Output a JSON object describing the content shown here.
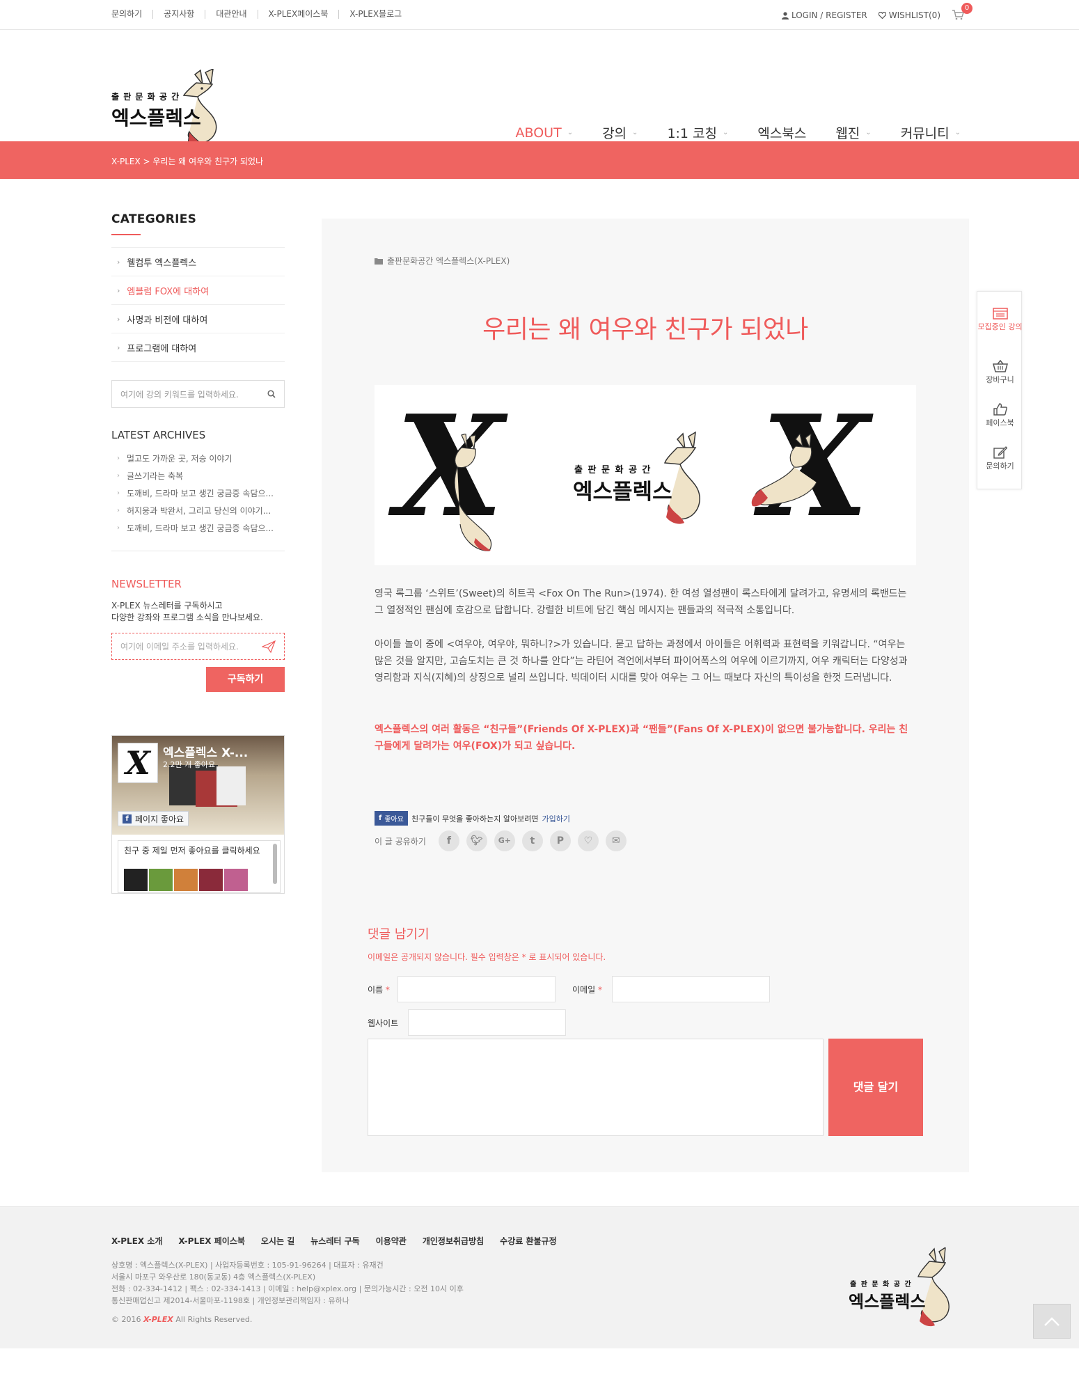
{
  "topbar": {
    "links": [
      "문의하기",
      "공지사항",
      "대관안내",
      "X-PLEX페이스북",
      "X-PLEX블로그"
    ],
    "login": "LOGIN / REGISTER",
    "wishlist": "WISHLIST(0)",
    "cart_count": "0"
  },
  "logo": {
    "small": "출 판 문 화 공 간",
    "big": "엑스플렉스"
  },
  "nav": [
    {
      "label": "ABOUT"
    },
    {
      "label": "강의"
    },
    {
      "label": "1:1 코칭"
    },
    {
      "label": "엑스북스"
    },
    {
      "label": "웹진"
    },
    {
      "label": "커뮤니티"
    }
  ],
  "breadcrumb": "X-PLEX > 우리는 왜 여우와 친구가 되었나",
  "sidebar": {
    "categories_title": "CATEGORIES",
    "categories": [
      "웰컴투 엑스플렉스",
      "엠블럼 FOX에 대하여",
      "사명과 비전에 대하여",
      "프로그램에 대하여"
    ],
    "search_placeholder": "여기에 강의 키워드를 입력하세요.",
    "archives_title": "LATEST ARCHIVES",
    "archives": [
      "멀고도 가까운 곳, 저승 이야기",
      "글쓰기라는 축복",
      "도깨비, 드라마 보고 생긴 궁금증 속담으...",
      "허지웅과 박완서, 그리고 당신의 이야기...",
      "도깨비, 드라마 보고 생긴 궁금증 속담으..."
    ],
    "newsletter_title": "NEWSLETTER",
    "newsletter_desc_1": "X-PLEX 뉴스레터를 구독하시고",
    "newsletter_desc_2": "다양한 강좌와 프로그램 소식을 만나보세요.",
    "newsletter_placeholder": "여기에 이메일 주소를 입력하세요.",
    "subscribe": "구독하기"
  },
  "facebook_box": {
    "thumb": "X",
    "name": "엑스플렉스 X-...",
    "likes": "2.2만 개 좋아요",
    "page_like": "페이지 좋아요",
    "feed": "친구 중 제일 먼저 좋아요를 클릭하세요"
  },
  "article": {
    "category": "출판문화공간 엑스플렉스(X-PLEX)",
    "title": "우리는 왜 여우와 친구가 되었나",
    "p1": "영국 록그룹 ‘스위트’(Sweet)의 히트곡 <Fox On The Run>(1974). 한 여성 열성팬이 록스타에게 달려가고, 유명세의 록밴드는 그 열정적인 팬심에 호감으로 답합니다. 강렬한 비트에 담긴 핵심 메시지는 팬들과의 적극적 소통입니다.",
    "p2": "아이들 놀이 중에 <여우야, 여우야, 뭐하니?>가 있습니다. 묻고 답하는 과정에서 아이들은 어휘력과 표현력을 키워갑니다. “여우는 많은 것을 알지만, 고슴도치는 큰 것 하나를 안다”는 라틴어 격언에서부터 파이어폭스의 여우에 이르기까지, 여우 캐릭터는 다양성과 영리함과 지식(지혜)의 상징으로 널리 쓰입니다. 빅데이터 시대를 맞아 여우는 그 어느 때보다 자신의 특이성을 한껏 드러냅니다.",
    "p3": "엑스플렉스의 여러 활동은 “친구들”(Friends Of X-PLEX)과 “팬들”(Fans Of X-PLEX)이 없으면 불가능합니다. 우리는 친구들에게 달려가는 여우(FOX)가 되고 싶습니다.",
    "fb_like": "좋아요",
    "fb_text": "친구들이 무엇을 좋아하는지 알아보려면",
    "fb_join": "가입하기",
    "share_label": "이 글 공유하기"
  },
  "comment": {
    "title": "댓글 남기기",
    "note": "이메일은 공개되지 않습니다. 필수 입력창은 * 로 표시되어 있습니다.",
    "name_label": "이름",
    "email_label": "이메일",
    "website_label": "웹사이트",
    "required": "*",
    "submit": "댓글 달기"
  },
  "float_menu": [
    "모집중인 강의",
    "장바구니",
    "페이스북",
    "문의하기"
  ],
  "footer": {
    "links": [
      "X-PLEX 소개",
      "X-PLEX 페이스북",
      "오시는 길",
      "뉴스레터 구독",
      "이용약관",
      "개인정보취급방침",
      "수강료 환불규정"
    ],
    "info": [
      "상호명 : 엑스플렉스(X-PLEX) | 사업자등록번호 : 105-91-96264 | 대표자 : 유재건",
      "서울시 마포구 와우산로 180(동교동) 4층 엑스플렉스(X-PLEX)",
      "전화 : 02-334-1412 | 팩스 : 02-334-1413 | 이메일 : help@xplex.org | 문의가능시간 : 오전 10시 이후",
      "통신판매업신고 제2014-서울마포-1198호 | 개인정보관리책임자 : 유하나"
    ],
    "copy_prefix": "© 2016",
    "copy_brand": "X-PLEX",
    "copy_suffix": "All Rights Reserved."
  },
  "colors": {
    "accent": "#ef5b5b",
    "facebook": "#3b5998"
  }
}
